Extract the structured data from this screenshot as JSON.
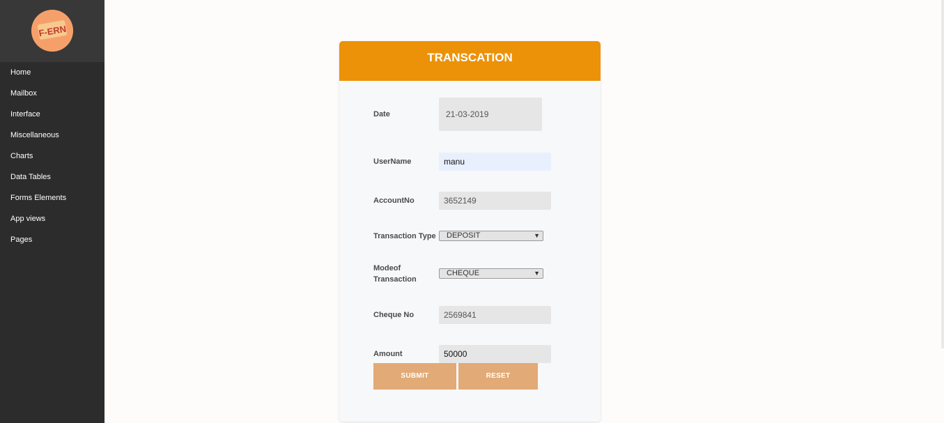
{
  "logo": {
    "text": "F-ERN"
  },
  "sidebar": {
    "items": [
      {
        "label": "Home"
      },
      {
        "label": "Mailbox"
      },
      {
        "label": "Interface"
      },
      {
        "label": "Miscellaneous"
      },
      {
        "label": "Charts"
      },
      {
        "label": "Data Tables"
      },
      {
        "label": "Forms Elements"
      },
      {
        "label": "App views"
      },
      {
        "label": "Pages"
      }
    ]
  },
  "form": {
    "title": "TRANSCATION",
    "date": {
      "label": "Date",
      "value": "21-03-2019"
    },
    "username": {
      "label": "UserName",
      "value": "manu"
    },
    "account": {
      "label": "AccountNo",
      "value": "3652149"
    },
    "transaction_type": {
      "label": "Transaction Type",
      "selected": "DEPOSIT"
    },
    "mode": {
      "label_line1": "Modeof",
      "label_line2": "Transaction",
      "selected": "CHEQUE"
    },
    "cheque": {
      "label": "Cheque No",
      "value": "2569841"
    },
    "amount": {
      "label": "Amount",
      "value": "50000"
    },
    "submit_label": "SUBMIT",
    "reset_label": "RESET"
  },
  "colors": {
    "sidebar_bg": "#2c2c2c",
    "header_orange": "#ec9208",
    "button_bg": "#e2aa76"
  }
}
